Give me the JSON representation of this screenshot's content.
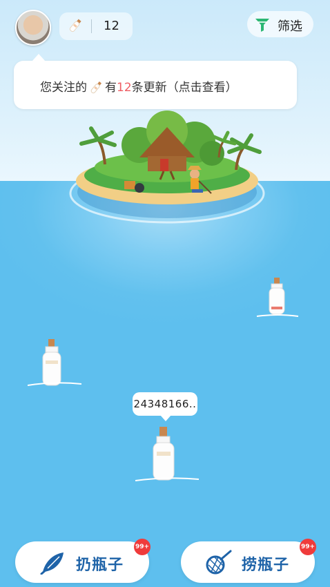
{
  "header": {
    "bottle_count": "12",
    "filter_label": "筛选"
  },
  "notice": {
    "prefix": "您关注的",
    "middle": "有",
    "count": "12",
    "suffix": "条更新（点击查看）"
  },
  "bottles": [
    {
      "label": "24348166.."
    }
  ],
  "actions": {
    "throw_label": "扔瓶子",
    "throw_badge": "99+",
    "catch_label": "捞瓶子",
    "catch_badge": "99+"
  },
  "colors": {
    "highlight": "#ee5c63",
    "button_text": "#1e63a8",
    "badge": "#ef3b3b",
    "sea": "#63c2ef"
  }
}
